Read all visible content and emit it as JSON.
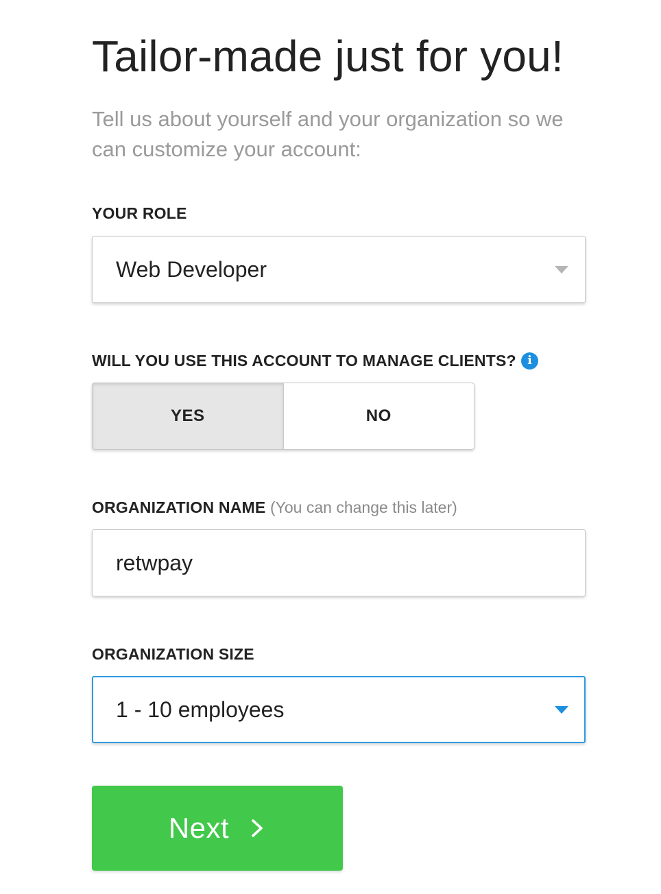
{
  "header": {
    "title": "Tailor-made just for you!",
    "subtitle": "Tell us about yourself and your organization so we can customize your account:"
  },
  "role": {
    "label": "YOUR ROLE",
    "value": "Web Developer",
    "caret_icon": "chevron-down-icon"
  },
  "clients": {
    "label": "WILL YOU USE THIS ACCOUNT TO MANAGE CLIENTS?",
    "info_icon": "info-icon",
    "info_glyph": "i",
    "options": [
      "YES",
      "NO"
    ],
    "selected": "YES"
  },
  "org_name": {
    "label": "ORGANIZATION NAME",
    "hint": "(You can change this later)",
    "value": "retwpay"
  },
  "org_size": {
    "label": "ORGANIZATION SIZE",
    "value": "1 - 10 employees",
    "caret_icon": "chevron-down-icon"
  },
  "next": {
    "label": "Next",
    "icon": "chevron-right-icon"
  },
  "colors": {
    "accent_blue": "#1d8fe0",
    "button_green": "#42c84a",
    "selected_toggle_bg": "#e6e6e6",
    "subtitle_gray": "#9a9a9a"
  }
}
